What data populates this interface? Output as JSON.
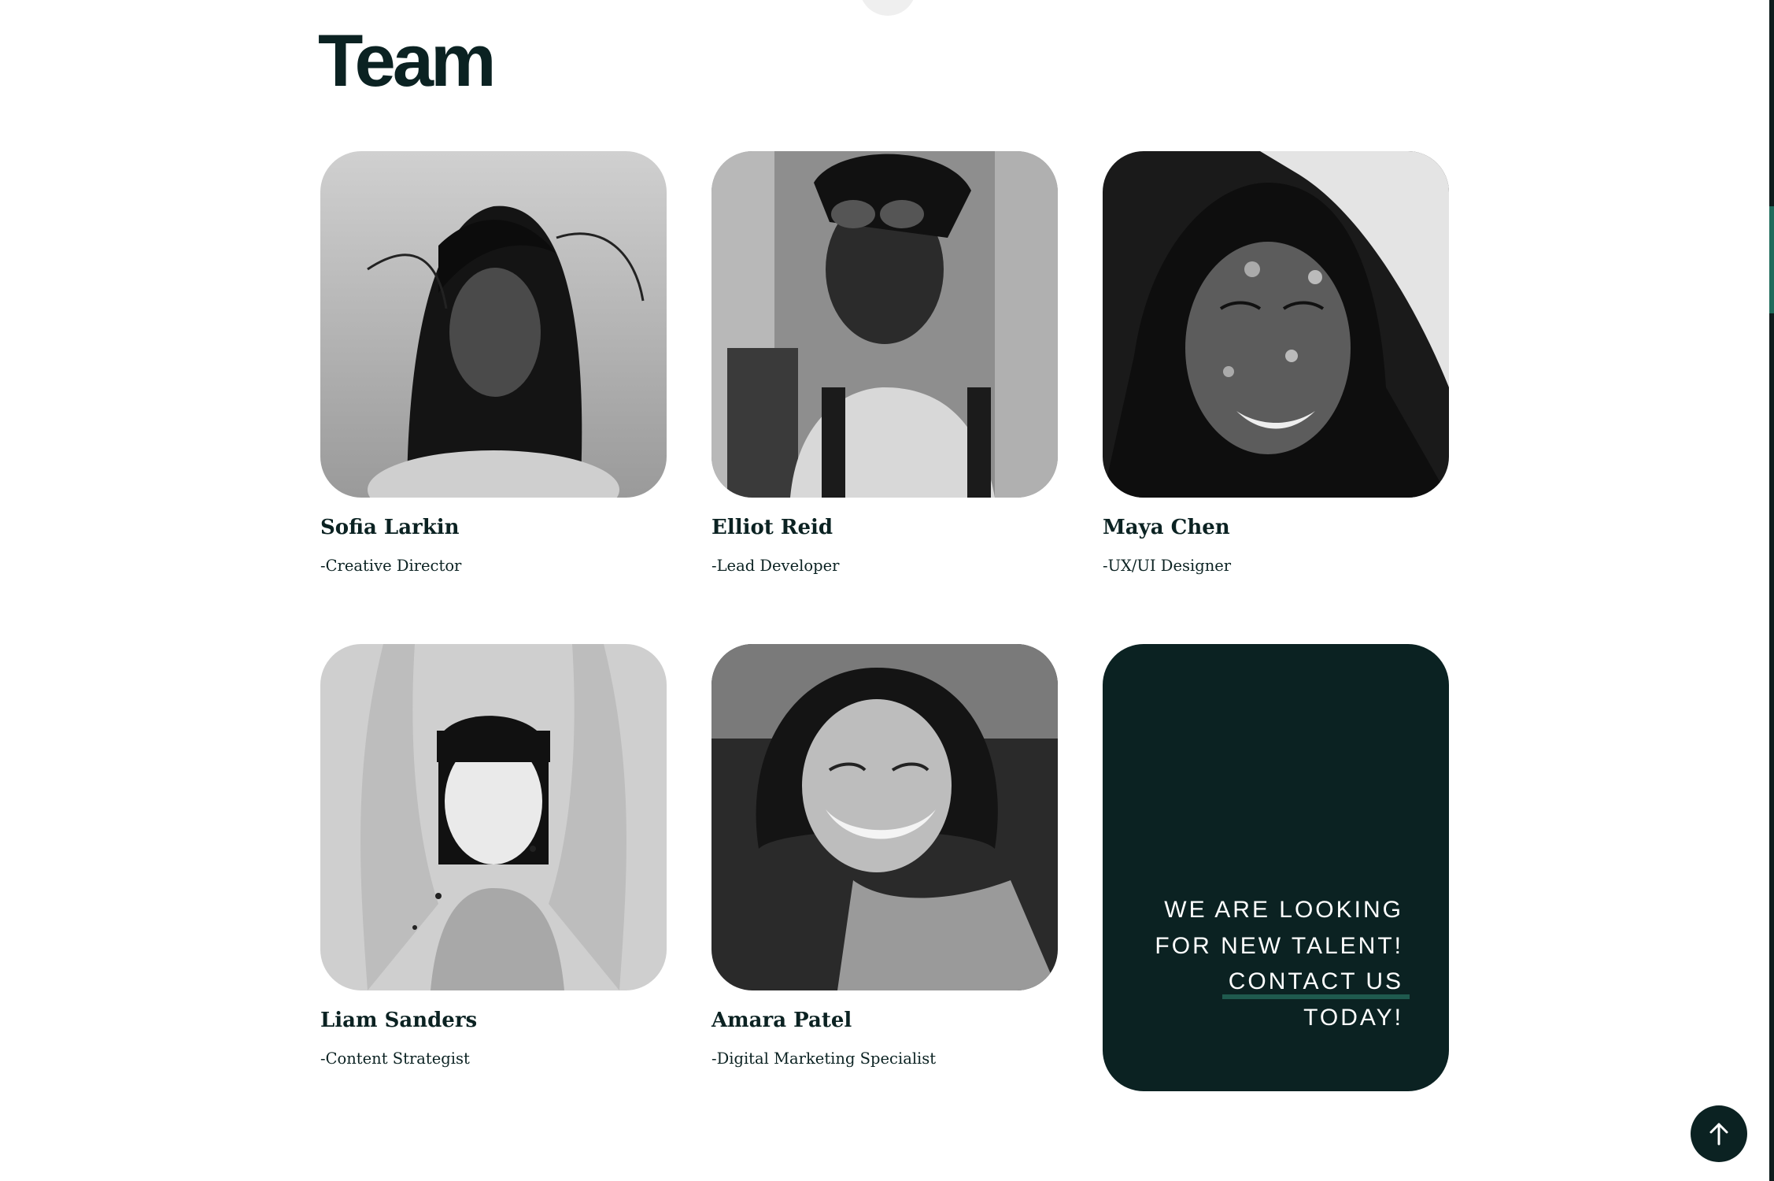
{
  "section": {
    "title": "Team"
  },
  "team": [
    {
      "name": "Sofia Larkin",
      "role": "-Creative Director"
    },
    {
      "name": "Elliot Reid",
      "role": "-Lead Developer"
    },
    {
      "name": "Maya Chen",
      "role": "-UX/UI Designer"
    },
    {
      "name": "Liam Sanders",
      "role": "-Content Strategist"
    },
    {
      "name": "Amara Patel",
      "role": "-Digital Marketing Specialist"
    }
  ],
  "cta": {
    "line1": "WE ARE LOOKING",
    "line2": "FOR NEW TALENT!",
    "link": "CONTACT US",
    "line4": "TODAY!"
  },
  "controls": {
    "back_to_top_icon": "arrow-up-icon"
  },
  "colors": {
    "accent": "#0b2222",
    "underline": "#1f5a4e",
    "background": "#ffffff"
  }
}
